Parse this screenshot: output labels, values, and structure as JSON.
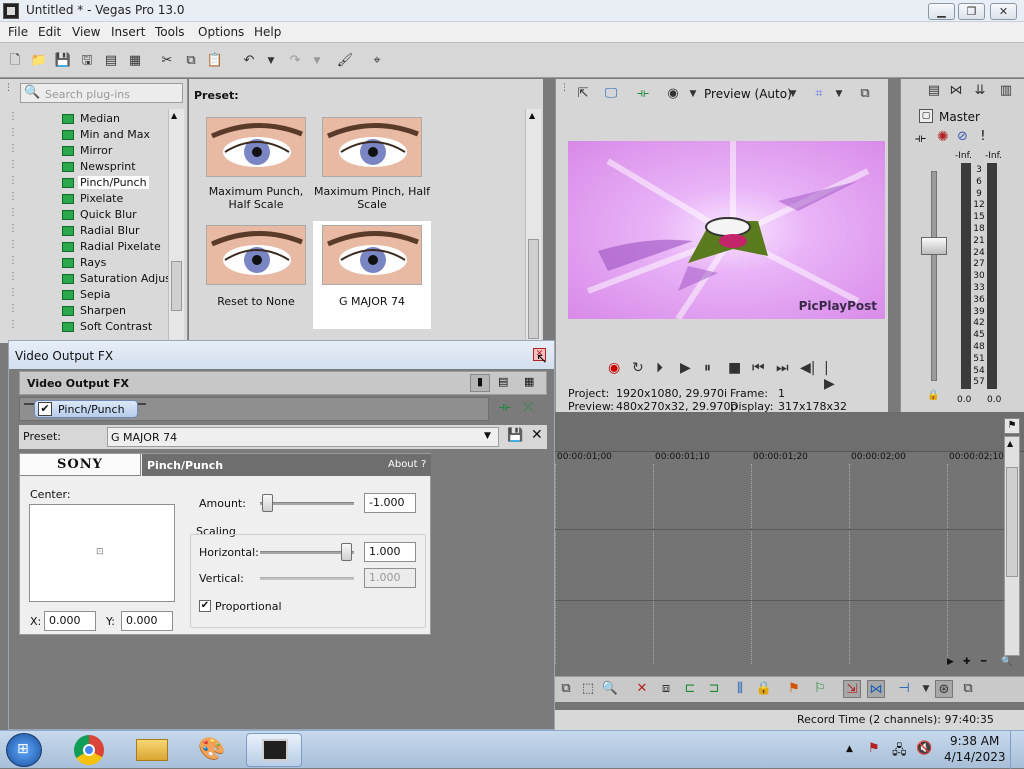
{
  "window": {
    "title": "Untitled * - Vegas Pro 13.0",
    "min_glyph": "▁",
    "max_glyph": "❐",
    "close_glyph": "✕"
  },
  "menu": [
    "File",
    "Edit",
    "View",
    "Insert",
    "Tools",
    "Options",
    "Help"
  ],
  "explorer": {
    "search_placeholder": "Search plug-ins",
    "plugins": [
      {
        "label": "Median",
        "selected": false
      },
      {
        "label": "Min and Max",
        "selected": false
      },
      {
        "label": "Mirror",
        "selected": false
      },
      {
        "label": "Newsprint",
        "selected": false
      },
      {
        "label": "Pinch/Punch",
        "selected": true
      },
      {
        "label": "Pixelate",
        "selected": false
      },
      {
        "label": "Quick Blur",
        "selected": false
      },
      {
        "label": "Radial Blur",
        "selected": false
      },
      {
        "label": "Radial Pixelate",
        "selected": false
      },
      {
        "label": "Rays",
        "selected": false
      },
      {
        "label": "Saturation Adjust",
        "selected": false
      },
      {
        "label": "Sepia",
        "selected": false
      },
      {
        "label": "Sharpen",
        "selected": false
      },
      {
        "label": "Soft Contrast",
        "selected": false
      }
    ]
  },
  "presets": {
    "heading": "Preset:",
    "items": [
      {
        "caption": "Maximum Punch, Half Scale"
      },
      {
        "caption": "Maximum Pinch, Half Scale"
      },
      {
        "caption": "Reset to None"
      },
      {
        "caption": "G MAJOR 74"
      }
    ],
    "selected_index": 3
  },
  "preview": {
    "mode": "Preview (Auto)",
    "watermark": "PicPlayPost",
    "project_label": "Project:",
    "project_value": "1920x1080, 29.970i",
    "frame_label": "Frame:",
    "frame_value": "1",
    "preview_label": "Preview:",
    "preview_value": "480x270x32, 29.970p",
    "display_label": "Display:",
    "display_value": "317x178x32"
  },
  "master": {
    "title": "Master",
    "peak_left": "-Inf.",
    "peak_right": "-Inf.",
    "scale": [
      "3",
      "6",
      "9",
      "12",
      "15",
      "18",
      "21",
      "24",
      "27",
      "30",
      "33",
      "36",
      "39",
      "42",
      "45",
      "48",
      "51",
      "54",
      "57"
    ],
    "level_left": "0.0",
    "level_right": "0.0"
  },
  "timeline": {
    "ticks": [
      "00:00:01;00",
      "00:00:01;10",
      "00:00:01;20",
      "00:00:02;00",
      "00:00:02;10"
    ],
    "record_time": "Record Time (2 channels): 97:40:35"
  },
  "dialog": {
    "title": "Video Output FX",
    "header": "Video Output FX",
    "chain_item": "Pinch/Punch",
    "preset_label": "Preset:",
    "preset_value": "G MAJOR 74",
    "brand": "SONY",
    "plugin_name": "Pinch/Punch",
    "about": "About",
    "about_q": "?",
    "center_label": "Center:",
    "x_label": "X:",
    "x_value": "0.000",
    "y_label": "Y:",
    "y_value": "0.000",
    "amount_label": "Amount:",
    "amount_value": "-1.000",
    "amount_level": 0.02,
    "scaling_label": "Scaling",
    "horizontal_label": "Horizontal:",
    "horizontal_value": "1.000",
    "horizontal_level": 0.98,
    "vertical_label": "Vertical:",
    "vertical_value": "1.000",
    "proportional_label": "Proportional",
    "proportional_checked": true
  },
  "taskbar": {
    "time": "9:38 AM",
    "date": "4/14/2023"
  },
  "colors": {
    "video_bg": "#d98bf0",
    "select_green": "#29a84b"
  }
}
